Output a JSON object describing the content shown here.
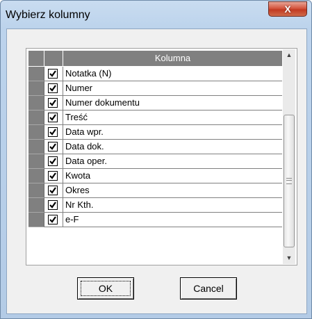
{
  "window": {
    "title": "Wybierz kolumny",
    "close_glyph": "X"
  },
  "grid": {
    "header": {
      "column_label": "Kolumna"
    },
    "rows": [
      {
        "label": "Notatka  (N)",
        "checked": true
      },
      {
        "label": "Numer",
        "checked": true
      },
      {
        "label": "Numer dokumentu",
        "checked": true
      },
      {
        "label": "Treść",
        "checked": true
      },
      {
        "label": "Data wpr.",
        "checked": true
      },
      {
        "label": "Data dok.",
        "checked": true
      },
      {
        "label": "Data oper.",
        "checked": true
      },
      {
        "label": "Kwota",
        "checked": true
      },
      {
        "label": "Okres",
        "checked": true
      },
      {
        "label": "Nr Kth.",
        "checked": true
      },
      {
        "label": "e-F",
        "checked": true
      }
    ],
    "scrollbar": {
      "up_glyph": "▲",
      "down_glyph": "▼"
    }
  },
  "buttons": {
    "ok_label": "OK",
    "cancel_label": "Cancel"
  }
}
